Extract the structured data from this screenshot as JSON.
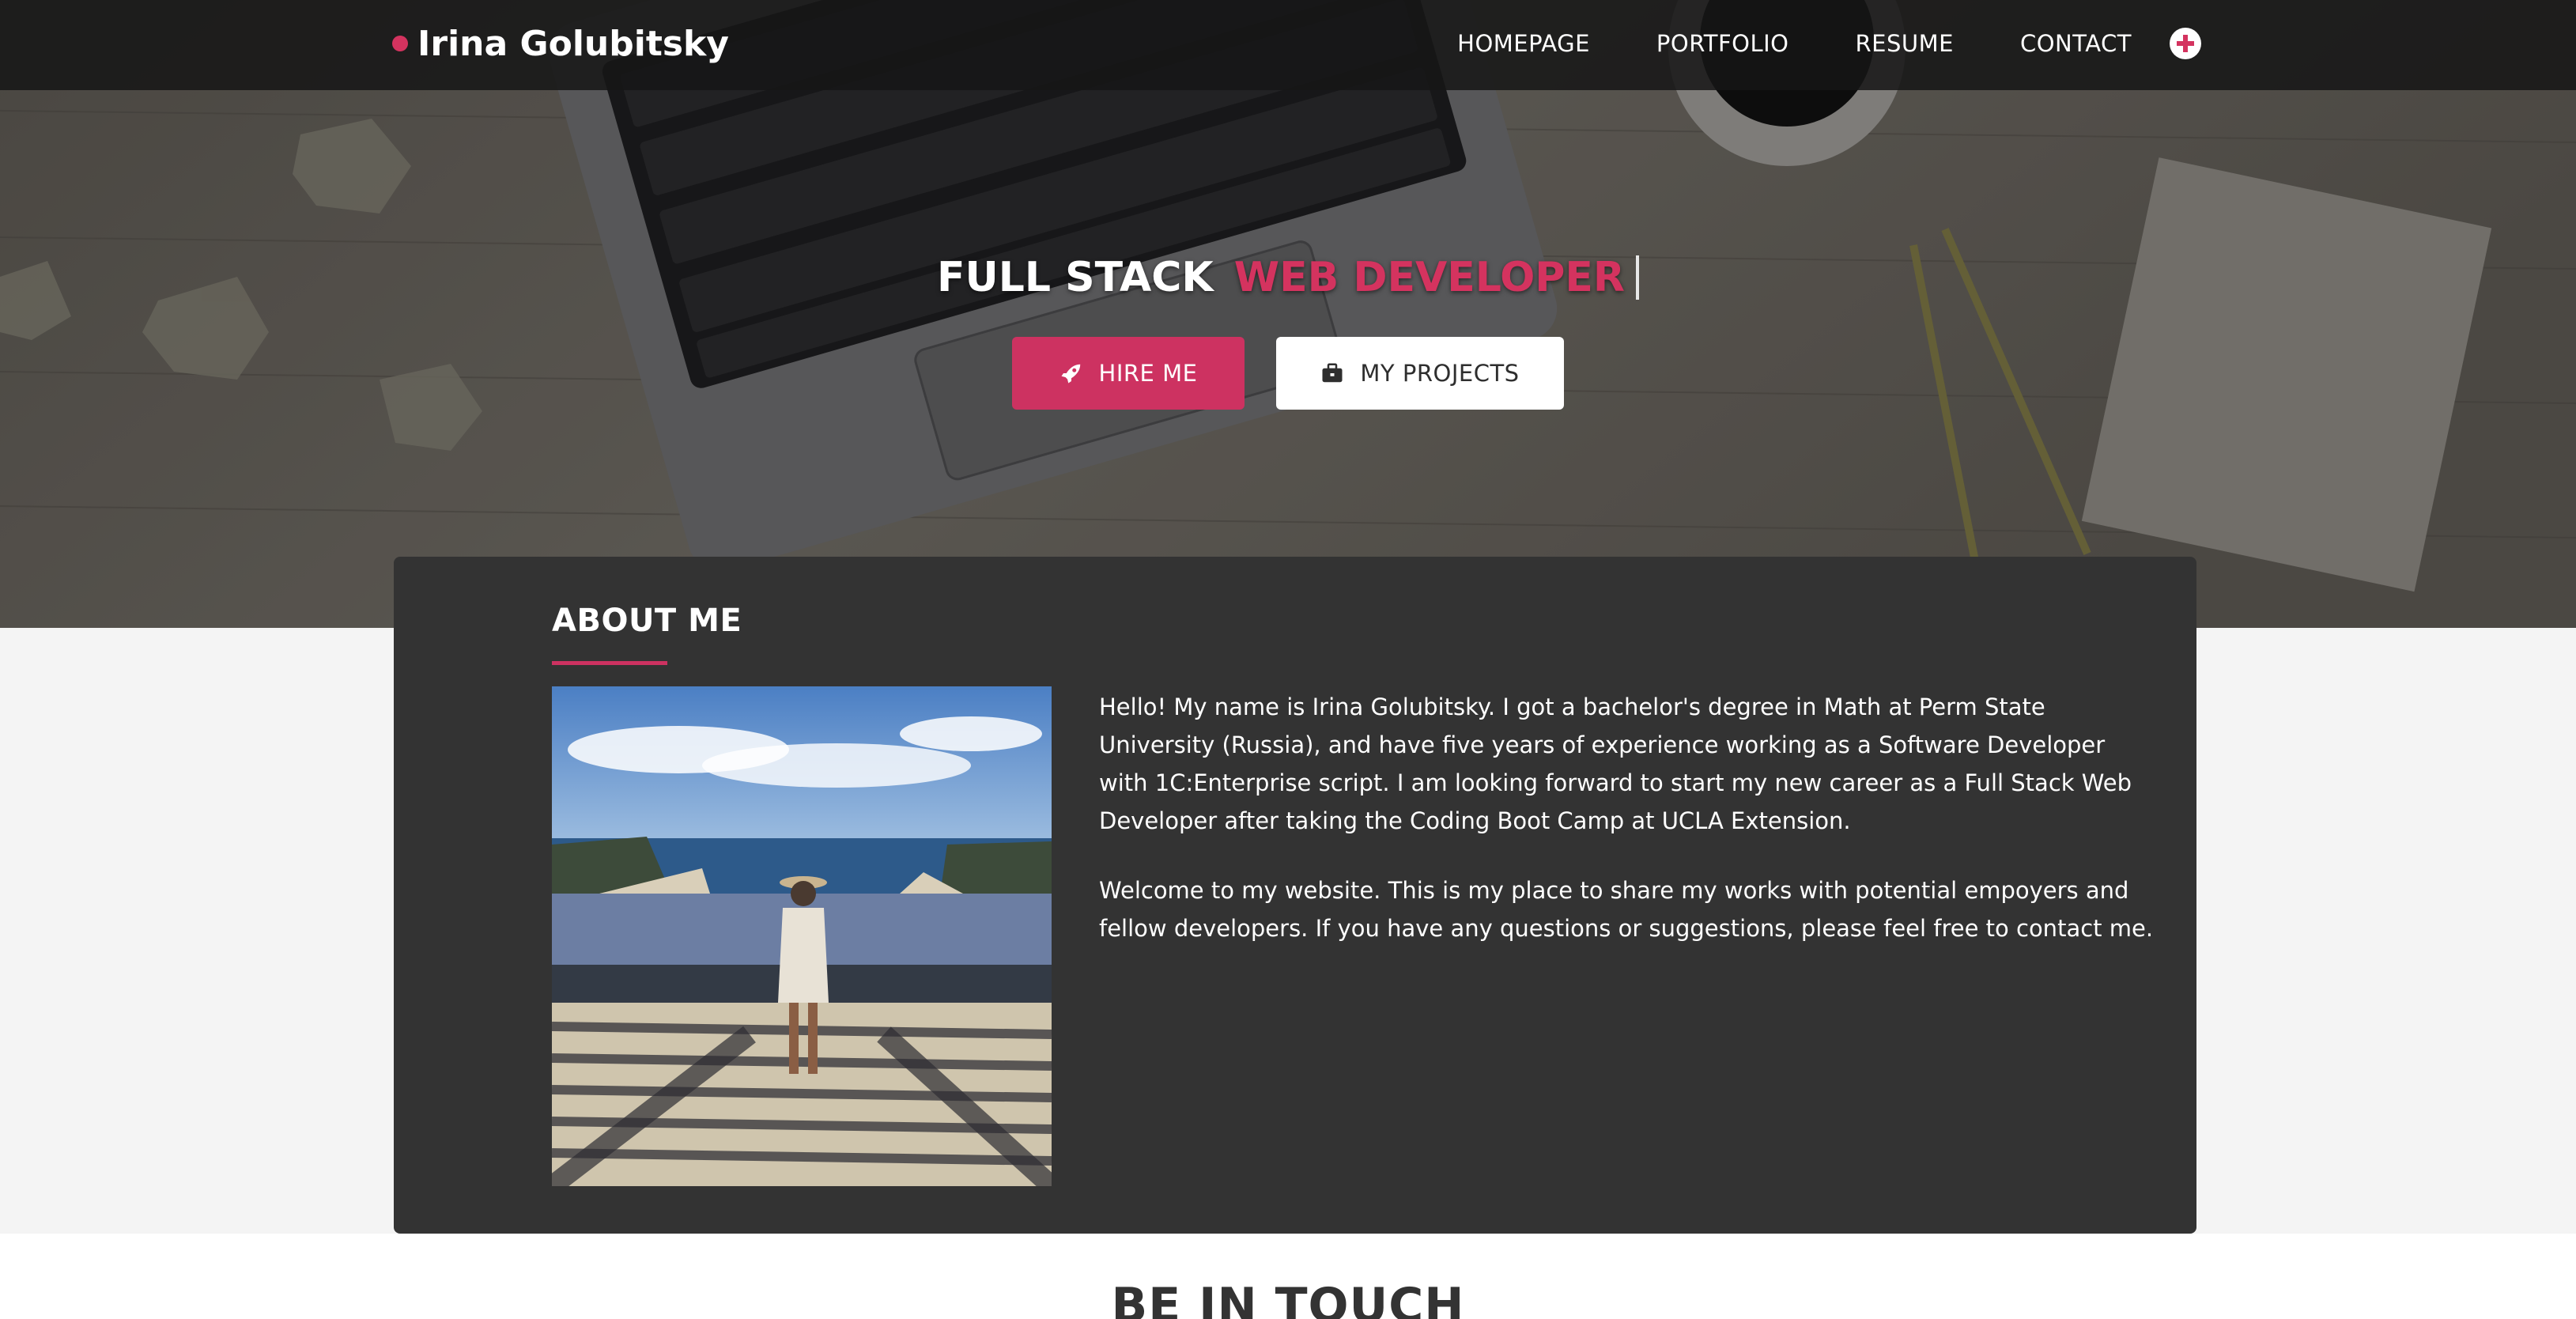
{
  "brand": {
    "name": "Irina Golubitsky"
  },
  "nav": {
    "items": [
      "HOMEPAGE",
      "PORTFOLIO",
      "RESUME",
      "CONTACT"
    ],
    "plus_icon": "plus-circle-icon"
  },
  "hero": {
    "headline_white": "FULL STACK",
    "headline_pink": "WEB DEVELOPER",
    "buttons": {
      "hire": {
        "label": "HIRE ME",
        "icon": "rocket-icon"
      },
      "projects": {
        "label": "MY PROJECTS",
        "icon": "briefcase-icon"
      }
    }
  },
  "about": {
    "title": "ABOUT ME",
    "paragraphs": [
      "Hello! My name is Irina Golubitsky. I got a bachelor's degree in Math at Perm State University (Russia), and have five years of experience working as a Software Developer with 1C:Enterprise script. I am looking forward to start my new career as a Full Stack Web Developer after taking the Coding Boot Camp at UCLA Extension.",
      "Welcome to my website. This is my place to share my works with potential empoyers and fellow developers. If you have any questions or suggestions, please feel free to contact me."
    ]
  },
  "touch": {
    "title": "BE IN TOUCH"
  },
  "colors": {
    "accent": "#cd3261",
    "card_bg": "#333333",
    "nav_bg": "#161616",
    "page_bg": "#f4f4f4"
  }
}
